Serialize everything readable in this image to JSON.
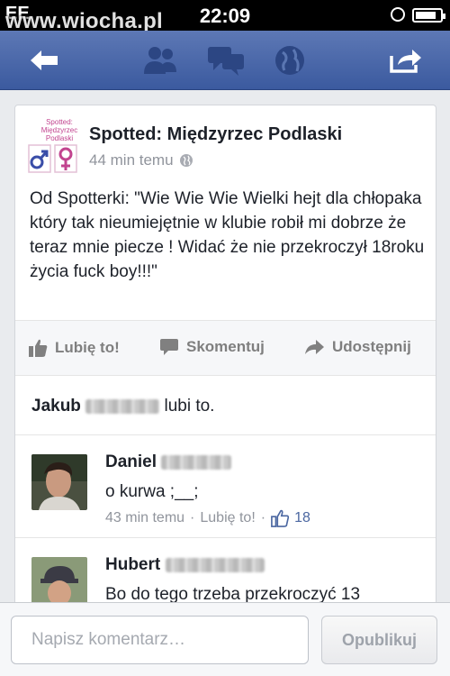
{
  "status_bar": {
    "carrier": "EE",
    "watermark": "www.wiocha.pl",
    "time": "22:09"
  },
  "nav": {
    "icons": [
      "back-arrow-icon",
      "friends-icon",
      "messages-icon",
      "globe-icon",
      "share-icon"
    ]
  },
  "post": {
    "page_name": "Spotted: Międzyrzec Podlaski",
    "avatar_text": "Spotted: Międzyrzec Podlaski",
    "time": "44 min temu",
    "text": "Od Spotterki: \"Wie Wie Wie Wielki hejt dla chłopaka który tak nieumiejętnie w klubie robił mi dobrze że teraz mnie piecze ! Widać że nie przekroczył 18roku życia fuck boy!!!\""
  },
  "actions": {
    "like": "Lubię to!",
    "comment": "Skomentuj",
    "share": "Udostępnij"
  },
  "likes": {
    "name": "Jakub",
    "suffix": "lubi to."
  },
  "comments": [
    {
      "author": "Daniel",
      "text": "o kurwa ;__;",
      "time": "43 min temu",
      "like_link": "Lubię to!",
      "like_count": "18"
    },
    {
      "author": "Hubert",
      "text": "Bo do tego trzeba przekroczyć 13"
    }
  ],
  "composer": {
    "placeholder": "Napisz komentarz…",
    "publish_label": "Opublikuj"
  },
  "colors": {
    "nav_blue": "#3b5a9f",
    "link_blue": "#4b67a1",
    "text_dark": "#1d2129",
    "text_grey": "#90949c"
  }
}
